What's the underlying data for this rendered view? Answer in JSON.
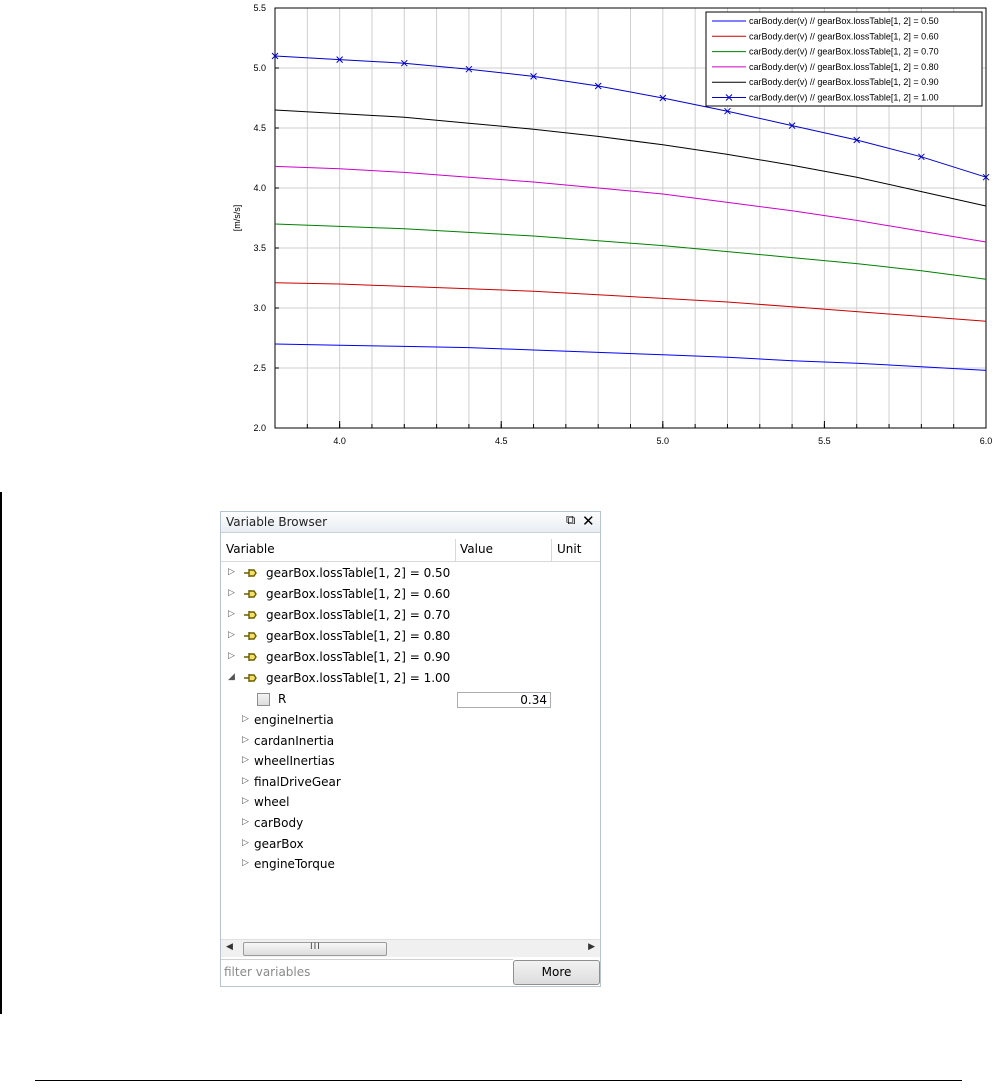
{
  "chart_data": {
    "type": "line",
    "title": "",
    "xlabel": "",
    "ylabel": "[m/s/s]",
    "xlim": [
      3.8,
      6.0
    ],
    "ylim": [
      2.0,
      5.5
    ],
    "x_ticks": [
      "4.0",
      "4.5",
      "5.0",
      "5.5",
      "6.0"
    ],
    "y_ticks": [
      "2.0",
      "2.5",
      "3.0",
      "3.5",
      "4.0",
      "4.5",
      "5.0",
      "5.5"
    ],
    "grid": true,
    "legend_position": "top-right",
    "x": [
      3.8,
      4.0,
      4.2,
      4.4,
      4.6,
      4.8,
      5.0,
      5.2,
      5.4,
      5.6,
      5.8,
      6.0
    ],
    "series": [
      {
        "name": "carBody.der(v) // gearBox.lossTable[1, 2] = 0.50",
        "color": "#0000ff",
        "marker": "none",
        "values": [
          2.7,
          2.69,
          2.68,
          2.67,
          2.65,
          2.63,
          2.61,
          2.59,
          2.56,
          2.54,
          2.51,
          2.48
        ]
      },
      {
        "name": "carBody.der(v) // gearBox.lossTable[1, 2] = 0.60",
        "color": "#cc0000",
        "marker": "none",
        "values": [
          3.21,
          3.2,
          3.18,
          3.16,
          3.14,
          3.11,
          3.08,
          3.05,
          3.01,
          2.97,
          2.93,
          2.89
        ]
      },
      {
        "name": "carBody.der(v) // gearBox.lossTable[1, 2] = 0.70",
        "color": "#008000",
        "marker": "none",
        "values": [
          3.7,
          3.68,
          3.66,
          3.63,
          3.6,
          3.56,
          3.52,
          3.47,
          3.42,
          3.37,
          3.31,
          3.24
        ]
      },
      {
        "name": "carBody.der(v) // gearBox.lossTable[1, 2] = 0.80",
        "color": "#cc00cc",
        "marker": "none",
        "values": [
          4.18,
          4.16,
          4.13,
          4.09,
          4.05,
          4.0,
          3.95,
          3.88,
          3.81,
          3.73,
          3.64,
          3.55
        ]
      },
      {
        "name": "carBody.der(v) // gearBox.lossTable[1, 2] = 0.90",
        "color": "#000000",
        "marker": "none",
        "values": [
          4.65,
          4.62,
          4.59,
          4.54,
          4.49,
          4.43,
          4.36,
          4.28,
          4.19,
          4.09,
          3.97,
          3.85
        ]
      },
      {
        "name": "carBody.der(v) // gearBox.lossTable[1, 2] = 1.00",
        "color": "#0000cc",
        "marker": "x",
        "values": [
          5.1,
          5.07,
          5.04,
          4.99,
          4.93,
          4.85,
          4.75,
          4.64,
          4.52,
          4.4,
          4.26,
          4.09
        ]
      }
    ]
  },
  "browser": {
    "title": "Variable Browser",
    "columns": {
      "variable": "Variable",
      "value": "Value",
      "unit": "Unit"
    },
    "results": [
      {
        "label": "gearBox.lossTable[1, 2] = 0.50"
      },
      {
        "label": "gearBox.lossTable[1, 2] = 0.60"
      },
      {
        "label": "gearBox.lossTable[1, 2] = 0.70"
      },
      {
        "label": "gearBox.lossTable[1, 2] = 0.80"
      },
      {
        "label": "gearBox.lossTable[1, 2] = 0.90"
      },
      {
        "label": "gearBox.lossTable[1, 2] = 1.00"
      }
    ],
    "param": {
      "name": "R",
      "value": "0.34"
    },
    "children": [
      "engineInertia",
      "cardanInertia",
      "wheelInertias",
      "finalDriveGear",
      "wheel",
      "carBody",
      "gearBox",
      "engineTorque"
    ],
    "filter_placeholder": "filter variables",
    "more_label": "More",
    "scroll_grip": "III"
  }
}
